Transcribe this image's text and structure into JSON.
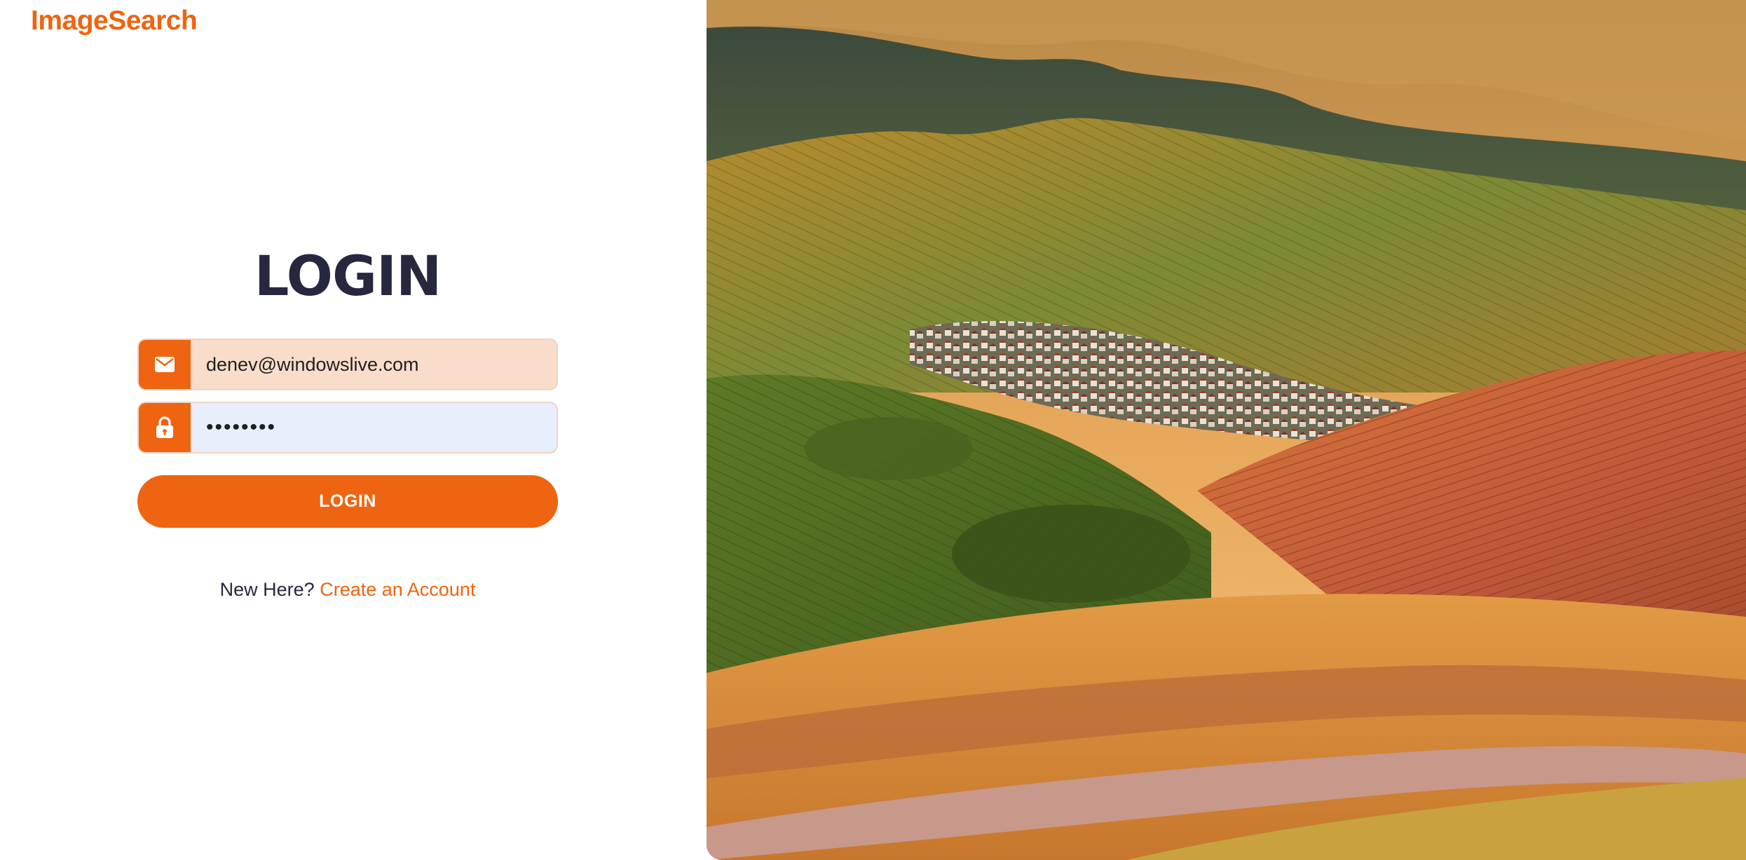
{
  "brand": {
    "name": "ImageSearch",
    "accent_color": "#ee6410",
    "title_color": "#27273f"
  },
  "login_form": {
    "title": "LOGIN",
    "email": {
      "value": "denev@windowslive.com",
      "icon": "mail-icon"
    },
    "password": {
      "value": "••••••••",
      "icon": "lock-icon"
    },
    "submit_label": "LOGIN"
  },
  "signup": {
    "prompt": "New Here?",
    "link_label": "Create an Account"
  },
  "hero_image": {
    "subject": "hillside-vineyard-village-at-sunset"
  }
}
